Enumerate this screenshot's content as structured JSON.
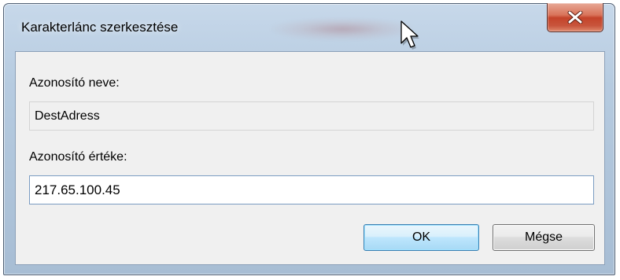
{
  "window": {
    "title": "Karakterlánc szerkesztése"
  },
  "form": {
    "name_label": "Azonosító neve:",
    "name_value": "DestAdress",
    "value_label": "Azonosító értéke:",
    "value_value": "217.65.100.45"
  },
  "buttons": {
    "ok_label": "OK",
    "cancel_label": "Mégse"
  },
  "icons": {
    "close": "close-icon",
    "cursor": "mouse-pointer-icon"
  },
  "colors": {
    "title_glass": "#b6cbe0",
    "close_red": "#c4432a",
    "dialog_face": "#f0f0f0",
    "ok_border": "#3c7fb1",
    "edit_border": "#7a9cc2"
  }
}
